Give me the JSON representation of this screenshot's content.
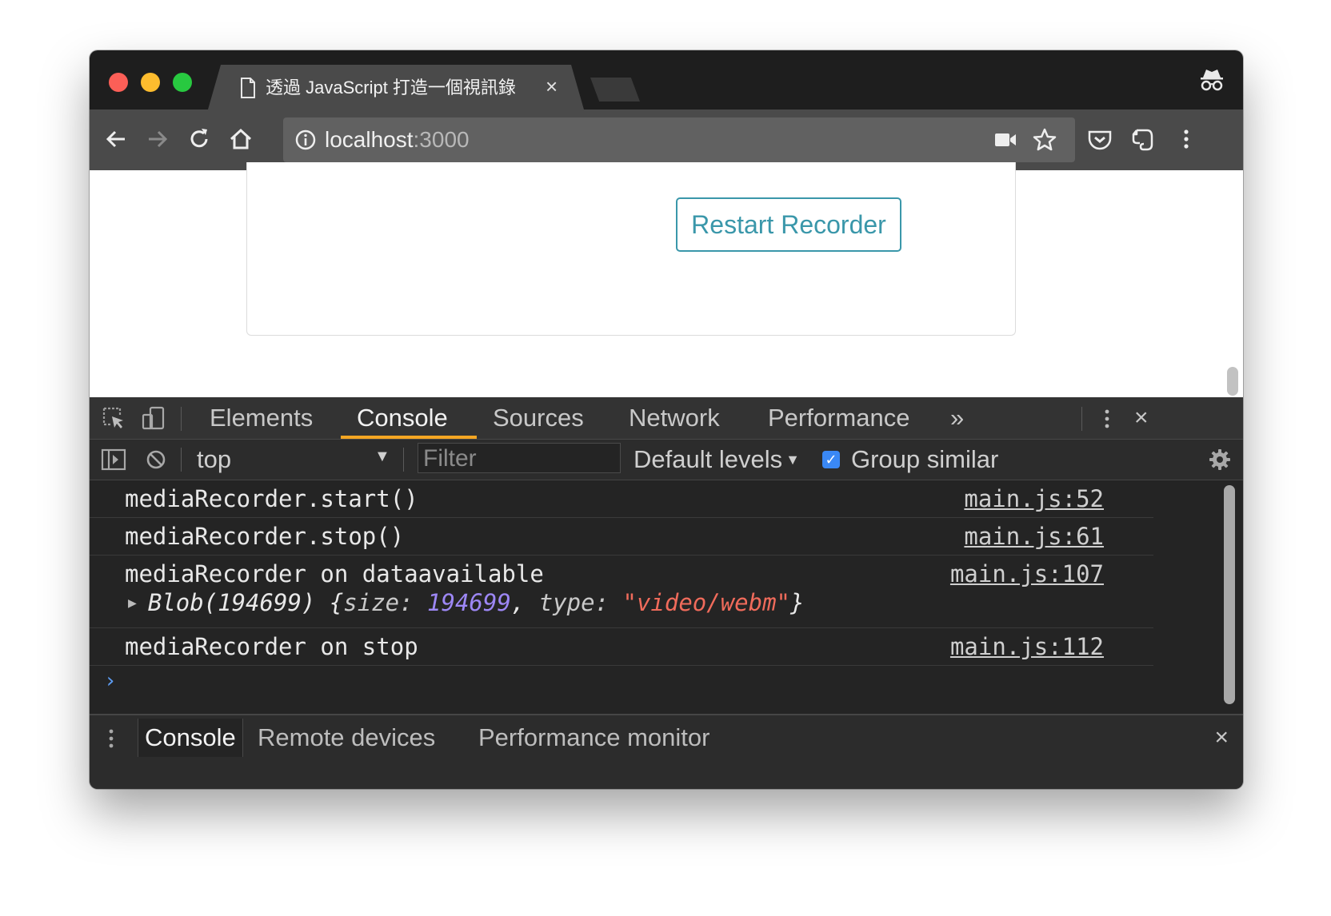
{
  "browser": {
    "tab_title": "透過 JavaScript 打造一個視訊錄",
    "tab_close": "×",
    "url_host": "localhost",
    "url_port": ":3000"
  },
  "page": {
    "restart_button": "Restart Recorder"
  },
  "devtools": {
    "tabs": [
      "Elements",
      "Console",
      "Sources",
      "Network",
      "Performance"
    ],
    "more_tabs": "»",
    "close": "×",
    "context": "top",
    "context_arrow": "▼",
    "filter_placeholder": "Filter",
    "levels": "Default levels",
    "levels_arrow": "▼",
    "group_similar_checked": "✓",
    "group_similar": "Group similar",
    "messages": [
      {
        "text": "mediaRecorder.start()",
        "source": "main.js:52"
      },
      {
        "text": "mediaRecorder.stop()",
        "source": "main.js:61"
      },
      {
        "text": "mediaRecorder on dataavailable",
        "source": "main.js:107"
      },
      {
        "text": "mediaRecorder on stop",
        "source": "main.js:112"
      }
    ],
    "blob": {
      "expand": "▶",
      "prefix": "Blob(194699) {",
      "size_key": "size: ",
      "size_val": "194699",
      "sep": ", ",
      "type_key": "type: ",
      "type_val": "\"video/webm\"",
      "suffix": "}"
    },
    "prompt": "›",
    "drawer_tabs": [
      "Console",
      "Remote devices",
      "Performance monitor"
    ],
    "drawer_close": "×"
  }
}
